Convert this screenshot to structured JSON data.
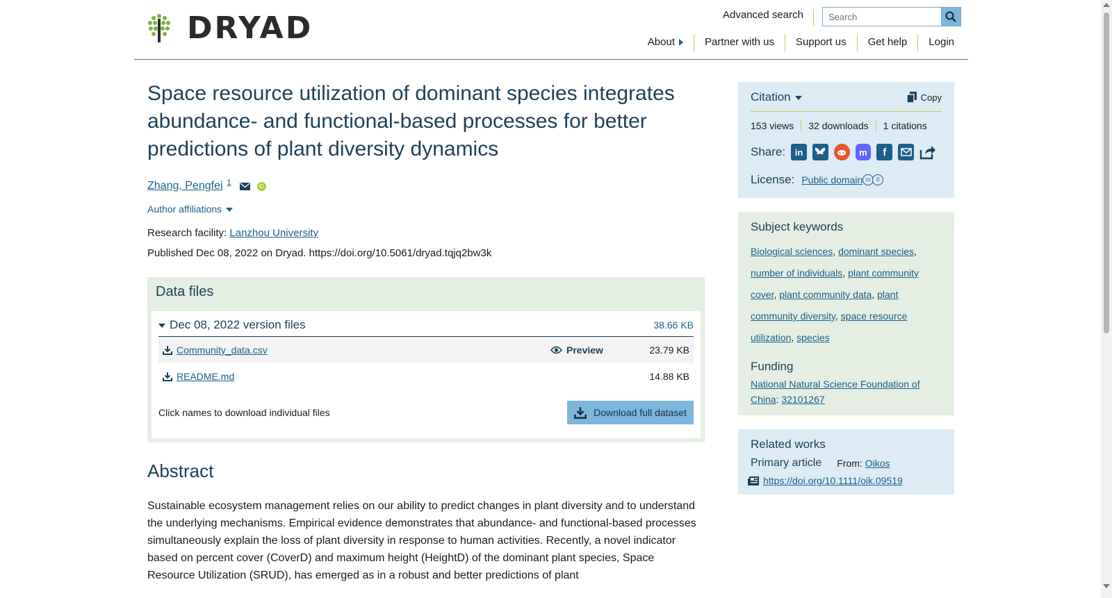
{
  "header": {
    "logo_text": "DRYAD",
    "advanced_search": "Advanced search",
    "search_placeholder": "Search",
    "nav": [
      "About",
      "Partner with us",
      "Support us",
      "Get help",
      "Login"
    ]
  },
  "dataset": {
    "title": "Space resource utilization of dominant species integrates abundance- and functional-based processes for better predictions of plant diversity dynamics",
    "author": "Zhang, Pengfei",
    "author_affiliation_ref": "1",
    "author_affiliations_label": "Author affiliations",
    "facility_label": "Research facility:",
    "facility": "Lanzhou University",
    "published": "Published Dec 08, 2022 on Dryad. https://doi.org/10.5061/dryad.tqjq2bw3k"
  },
  "data_files": {
    "heading": "Data files",
    "version_label": "Dec 08, 2022 version files",
    "version_size": "38.66 KB",
    "files": [
      {
        "name": "Community_data.csv",
        "preview": "Preview",
        "size": "23.79 KB"
      },
      {
        "name": "README.md",
        "size": "14.88 KB"
      }
    ],
    "hint": "Click names to download individual files",
    "download_label": "Download full dataset"
  },
  "abstract": {
    "heading": "Abstract",
    "text": "Sustainable ecosystem management relies on our ability to predict changes in plant diversity and to understand the underlying mechanisms. Empirical evidence demonstrates that abundance- and functional-based processes simultaneously explain the loss of plant diversity in response to human activities. Recently, a novel indicator based on percent cover (CoverD) and maximum height (HeightD) of the dominant plant species, Space Resource Utilization (SRUD), has emerged as in a robust and better predictions of plant"
  },
  "sidebar": {
    "citation_label": "Citation",
    "copy_label": "Copy",
    "stats": [
      "153 views",
      "32 downloads",
      "1 citations"
    ],
    "share_label": "Share:",
    "share_icons": [
      "linkedin-icon",
      "bluesky-icon",
      "reddit-icon",
      "mastodon-icon",
      "facebook-icon",
      "email-icon",
      "share-icon"
    ],
    "license_label": "License:",
    "license_value": "Public domain",
    "keywords_title": "Subject keywords",
    "keywords": [
      "Biological sciences",
      "dominant species",
      "number of individuals",
      "plant community cover",
      "plant community data",
      "plant community diversity",
      "space resource utilization",
      "species"
    ],
    "funding_title": "Funding",
    "funder": "National Natural Science Foundation of China",
    "grant": "32101267",
    "related_title": "Related works",
    "primary_article_label": "Primary article",
    "from_label": "From:",
    "from_value": "Oikos",
    "related_doi": "https://doi.org/10.1111/oik.09519"
  },
  "colors": {
    "primary_text": "#1e4157",
    "link": "#1d5f8a",
    "green_panel": "#e4eee3",
    "blue_panel": "#dcebf4",
    "download_button": "#7cb6da",
    "accent_divider": "#c2cf5a"
  }
}
